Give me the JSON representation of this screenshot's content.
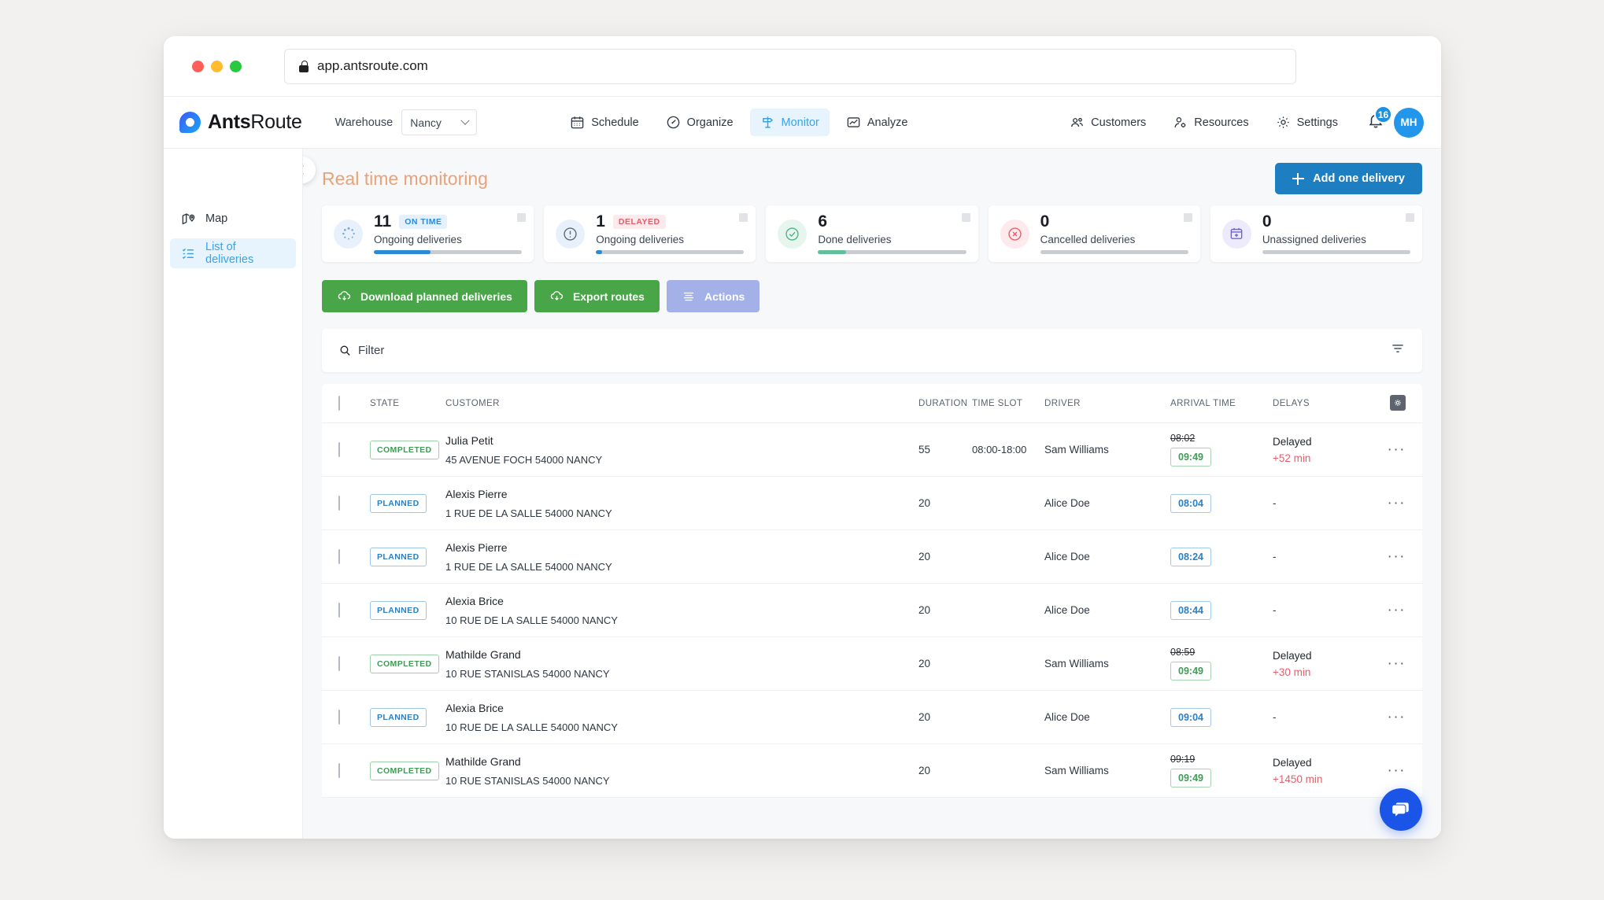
{
  "browser": {
    "url": "app.antsroute.com",
    "lock_icon": "lock-icon"
  },
  "brand": {
    "name_bold": "Ants",
    "name_light": "Route"
  },
  "header": {
    "warehouse_label": "Warehouse",
    "warehouse_value": "Nancy",
    "nav": [
      {
        "label": "Schedule",
        "icon": "calendar-icon",
        "active": false
      },
      {
        "label": "Organize",
        "icon": "gauge-icon",
        "active": false
      },
      {
        "label": "Monitor",
        "icon": "signpost-icon",
        "active": true
      },
      {
        "label": "Analyze",
        "icon": "chart-line-icon",
        "active": false
      }
    ],
    "nav_right": [
      {
        "label": "Customers",
        "icon": "people-icon"
      },
      {
        "label": "Resources",
        "icon": "person-gear-icon"
      },
      {
        "label": "Settings",
        "icon": "gear-icon"
      }
    ],
    "notifications_count": "16",
    "avatar_initials": "MH"
  },
  "sidebar": {
    "items": [
      {
        "label": "Map",
        "icon": "map-icon",
        "active": false
      },
      {
        "label": "List of deliveries",
        "icon": "list-check-icon",
        "active": true
      }
    ]
  },
  "page": {
    "title": "Real time monitoring",
    "add_delivery_label": "Add one delivery"
  },
  "cards": [
    {
      "number": "11",
      "pill": "ON TIME",
      "pill_type": "ontime",
      "label": "Ongoing deliveries",
      "icon": "spinner-icon",
      "icon_bg": "#e8f1fb",
      "icon_color": "#3f8fd4",
      "progress_pct": 38,
      "progress_color": "#2b8ad6"
    },
    {
      "number": "1",
      "pill": "DELAYED",
      "pill_type": "delayed",
      "label": "Ongoing deliveries",
      "icon": "alert-circle-icon",
      "icon_bg": "#e8f1fb",
      "icon_color": "#4a5a6a",
      "progress_pct": 4,
      "progress_color": "#2b8ad6"
    },
    {
      "number": "6",
      "pill": "",
      "pill_type": "",
      "label": "Done deliveries",
      "icon": "check-circle-icon",
      "icon_bg": "#e6f5ee",
      "icon_color": "#4fb487",
      "progress_pct": 19,
      "progress_color": "#63bf9b"
    },
    {
      "number": "0",
      "pill": "",
      "pill_type": "",
      "label": "Cancelled deliveries",
      "icon": "x-circle-icon",
      "icon_bg": "#fdeaec",
      "icon_color": "#e0636f",
      "progress_pct": 0,
      "progress_color": "#e0636f"
    },
    {
      "number": "0",
      "pill": "",
      "pill_type": "",
      "label": "Unassigned deliveries",
      "icon": "calendar-plus-icon",
      "icon_bg": "#eceafb",
      "icon_color": "#6f5fd0",
      "progress_pct": 0,
      "progress_color": "#6f5fd0"
    }
  ],
  "toolbar": {
    "download_label": "Download planned deliveries",
    "export_label": "Export routes",
    "actions_label": "Actions"
  },
  "filter": {
    "placeholder": "Filter",
    "value": "Filter"
  },
  "table": {
    "columns": {
      "state": "STATE",
      "customer": "CUSTOMER",
      "duration": "DURATION",
      "time_slot": "TIME SLOT",
      "driver": "DRIVER",
      "arrival_time": "ARRIVAL TIME",
      "delays": "DELAYS"
    },
    "rows": [
      {
        "state": "COMPLETED",
        "state_type": "completed",
        "customer": "Julia Petit",
        "address": "45 AVENUE FOCH 54000 NANCY",
        "duration": "55",
        "time_slot": "08:00-18:00",
        "driver": "Sam Williams",
        "arrival_planned": "08:02",
        "arrival_actual": "09:49",
        "arrival_type": "green",
        "delay_title": "Delayed",
        "delay_value": "+52 min"
      },
      {
        "state": "PLANNED",
        "state_type": "planned",
        "customer": "Alexis Pierre",
        "address": "1 RUE DE LA SALLE 54000 NANCY",
        "duration": "20",
        "time_slot": "",
        "driver": "Alice Doe",
        "arrival_planned": "",
        "arrival_actual": "08:04",
        "arrival_type": "blue",
        "delay_title": "",
        "delay_value": "-"
      },
      {
        "state": "PLANNED",
        "state_type": "planned",
        "customer": "Alexis Pierre",
        "address": "1 RUE DE LA SALLE 54000 NANCY",
        "duration": "20",
        "time_slot": "",
        "driver": "Alice Doe",
        "arrival_planned": "",
        "arrival_actual": "08:24",
        "arrival_type": "blue",
        "delay_title": "",
        "delay_value": "-"
      },
      {
        "state": "PLANNED",
        "state_type": "planned",
        "customer": "Alexia Brice",
        "address": "10 RUE DE LA SALLE 54000 NANCY",
        "duration": "20",
        "time_slot": "",
        "driver": "Alice Doe",
        "arrival_planned": "",
        "arrival_actual": "08:44",
        "arrival_type": "blue",
        "delay_title": "",
        "delay_value": "-"
      },
      {
        "state": "COMPLETED",
        "state_type": "completed",
        "customer": "Mathilde Grand",
        "address": "10 RUE STANISLAS 54000 NANCY",
        "duration": "20",
        "time_slot": "",
        "driver": "Sam Williams",
        "arrival_planned": "08:59",
        "arrival_actual": "09:49",
        "arrival_type": "green",
        "delay_title": "Delayed",
        "delay_value": "+30 min"
      },
      {
        "state": "PLANNED",
        "state_type": "planned",
        "customer": "Alexia Brice",
        "address": "10 RUE DE LA SALLE 54000 NANCY",
        "duration": "20",
        "time_slot": "",
        "driver": "Alice Doe",
        "arrival_planned": "",
        "arrival_actual": "09:04",
        "arrival_type": "blue",
        "delay_title": "",
        "delay_value": "-"
      },
      {
        "state": "COMPLETED",
        "state_type": "completed",
        "customer": "Mathilde Grand",
        "address": "10 RUE STANISLAS 54000 NANCY",
        "duration": "20",
        "time_slot": "",
        "driver": "Sam Williams",
        "arrival_planned": "09:19",
        "arrival_actual": "09:49",
        "arrival_type": "green",
        "delay_title": "Delayed",
        "delay_value": "+1450 min"
      }
    ],
    "row_menu_glyph": "···"
  },
  "colors": {
    "accent_blue": "#1d7ec2",
    "title_orange": "#e8a278",
    "green_button": "#48a548",
    "lilac_button": "#a4b0e8",
    "chat_blue": "#1a55e8"
  }
}
